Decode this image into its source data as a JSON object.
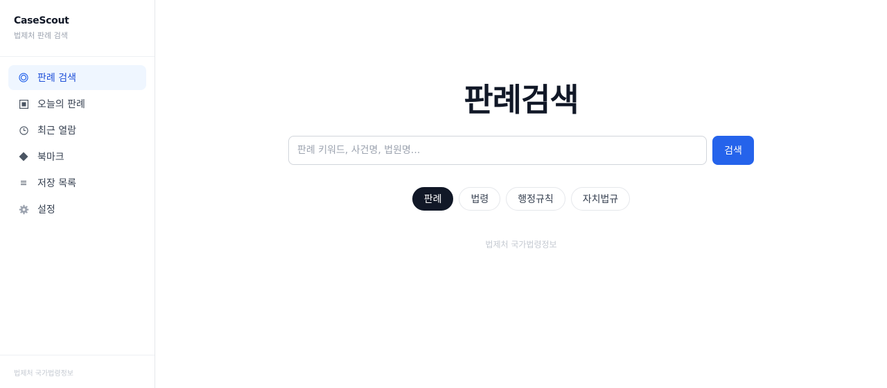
{
  "brand": {
    "title": "CaseScout",
    "subtitle": "법제처 판례 검색"
  },
  "sidebar": {
    "items": [
      {
        "label": "판례 검색",
        "icon": "target-icon",
        "active": true
      },
      {
        "label": "오늘의 판례",
        "icon": "square-icon",
        "active": false
      },
      {
        "label": "최근 열람",
        "icon": "clock-icon",
        "active": false
      },
      {
        "label": "북마크",
        "icon": "diamond-icon",
        "active": false
      },
      {
        "label": "저장 목록",
        "icon": "list-icon",
        "active": false
      },
      {
        "label": "설정",
        "icon": "gear-icon",
        "active": false
      }
    ],
    "footer": "법제처 국가법령정보"
  },
  "main": {
    "title": "판례검색",
    "search": {
      "placeholder": "판례 키워드, 사건명, 법원명...",
      "value": "",
      "button_label": "검색"
    },
    "chips": [
      {
        "label": "판례",
        "active": true
      },
      {
        "label": "법령",
        "active": false
      },
      {
        "label": "행정규칙",
        "active": false
      },
      {
        "label": "자치법규",
        "active": false
      }
    ],
    "source_note": "법제처 국가법령정보"
  },
  "colors": {
    "accent": "#2563eb",
    "active_bg": "#eff6ff",
    "chip_active": "#111827"
  }
}
